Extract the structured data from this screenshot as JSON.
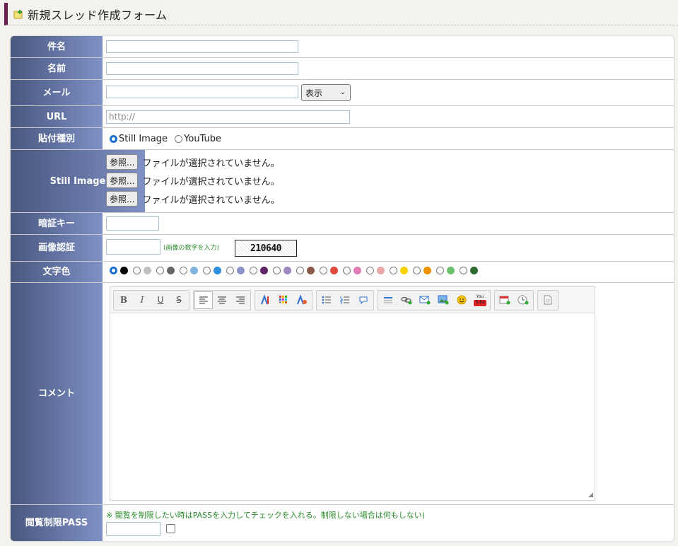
{
  "header": {
    "title": "新規スレッド作成フォーム"
  },
  "fields": {
    "subject": {
      "label": "件名",
      "value": ""
    },
    "name": {
      "label": "名前",
      "value": ""
    },
    "mail": {
      "label": "メール",
      "value": "",
      "select_value": "表示"
    },
    "url": {
      "label": "URL",
      "placeholder": "http://"
    },
    "paste_type": {
      "label": "貼付種別",
      "options": [
        "Still Image",
        "YouTube"
      ],
      "selected": "Still Image"
    },
    "still_image": {
      "label": "Still Image",
      "browse_label": "参照...",
      "no_file_text": "ファイルが選択されていません。"
    },
    "pin_key": {
      "label": "暗証キー",
      "value": ""
    },
    "captcha": {
      "label": "画像認証",
      "value": "",
      "hint": "(画像の数字を入力)",
      "code": "210640"
    },
    "text_color": {
      "label": "文字色",
      "colors": [
        "#000000",
        "#c0c0c0",
        "#666666",
        "#7fb4e0",
        "#2e8fde",
        "#8c93c9",
        "#5e2566",
        "#9d89c0",
        "#8c5a4a",
        "#e04a3a",
        "#e07bb4",
        "#e8a8a8",
        "#f6d200",
        "#f09000",
        "#6cc06c",
        "#2f6b2f"
      ],
      "selected_index": 0
    },
    "comment": {
      "label": "コメント",
      "toolbar": {
        "bold": "B",
        "italic": "I",
        "underline": "U",
        "strike": "S",
        "youtube": "You Tube"
      }
    },
    "view_pass": {
      "label": "閲覧制限PASS",
      "note": "※ 閲覧を制限したい時はPASSを入力してチェックを入れる。制限しない場合は何もしない)",
      "value": ""
    }
  }
}
